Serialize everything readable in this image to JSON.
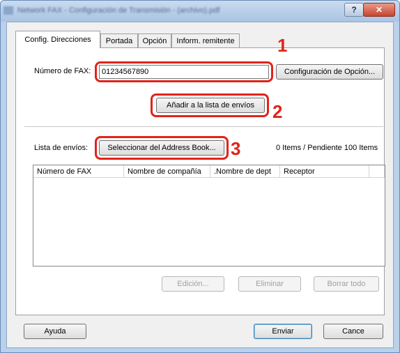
{
  "window": {
    "title": "Network FAX - Configuración de Transmisión - (archivo).pdf",
    "help_glyph": "?",
    "close_glyph": "✕"
  },
  "tabs": [
    {
      "label": "Config. Direcciones"
    },
    {
      "label": "Portada"
    },
    {
      "label": "Opción"
    },
    {
      "label": "Inform. remitente"
    }
  ],
  "fax": {
    "label": "Número de FAX:",
    "value": "01234567890",
    "option_button": "Configuración de Opción..."
  },
  "add_button": "Añadir a la lista de envíos",
  "dest": {
    "label": "Lista de envíos:",
    "address_book_button": "Seleccionar del Address Book...",
    "count": "0 Items / Pendiente 100 Items"
  },
  "list": {
    "columns": [
      "Número de FAX",
      "Nombre de compañía",
      ".Nombre de dept",
      "Receptor"
    ]
  },
  "list_buttons": {
    "edit": "Edición...",
    "delete": "Eliminar",
    "clear_all": "Borrar todo"
  },
  "footer": {
    "help": "Ayuda",
    "send": "Enviar",
    "cancel": "Cance"
  },
  "callouts": [
    "1",
    "2",
    "3"
  ],
  "colors": {
    "callout": "#e2231a",
    "close_button": "#c6452d",
    "titlebar": "#b9d1ea"
  }
}
